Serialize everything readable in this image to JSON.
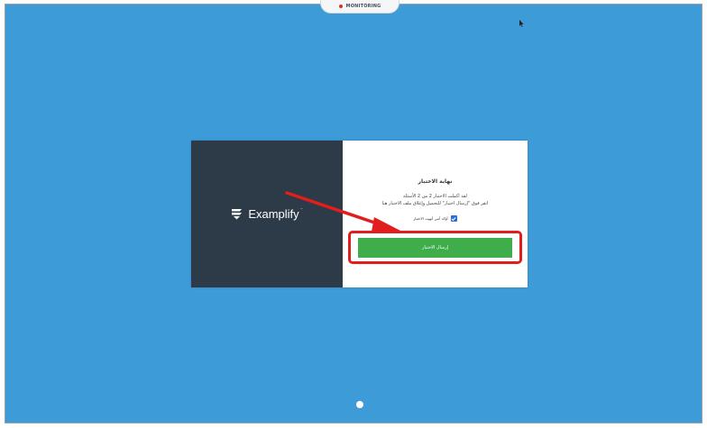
{
  "monitoring": {
    "label": "MONITORING",
    "rec_color": "#e0302a"
  },
  "brand": {
    "name": "Examplify",
    "trademark": "™",
    "logo_icon": "examplify-logo-icon",
    "panel_color": "#2d3a48"
  },
  "exam_end": {
    "title": "نهاية الاختبار",
    "line1": "لقد أكملت الاختبار 2 من 2 الأسئلة",
    "line2": "انقر فوق \"إرسال اختبار\" للتحميل وإغلاق ملف الاختبار هنا",
    "confirm_checked": true,
    "confirm_label": "أؤكد أنني أنهيت الاختبار",
    "submit_label": "إرسال الاختبار",
    "submit_color": "#3fae4a"
  },
  "annotations": {
    "highlight_color": "#e21d1d"
  },
  "background_color": "#3d9bd8"
}
